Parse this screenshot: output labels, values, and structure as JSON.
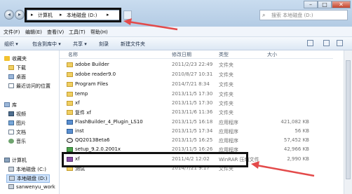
{
  "address": {
    "parts": [
      "▸",
      "计算机",
      "▸",
      "本地磁盘 (D:)",
      "▸"
    ]
  },
  "search": {
    "placeholder": "搜索 本地磁盘 (D:)"
  },
  "window_controls": {
    "minimize": "–",
    "maximize": "□",
    "close": "✕"
  },
  "menu": [
    "文件(F)",
    "编辑(E)",
    "查看(V)",
    "工具(T)",
    "帮助(H)"
  ],
  "toolbar": {
    "organize": "组织 ▾",
    "include": "包含到库中 ▾",
    "share": "共享 ▾",
    "burn": "刻录",
    "new_folder": "新建文件夹"
  },
  "nav": {
    "favorites": "收藏夹",
    "downloads": "下载",
    "desktop": "桌面",
    "recent": "最近访问的位置",
    "libraries": "库",
    "videos": "视频",
    "pictures": "图片",
    "documents": "文档",
    "music": "音乐",
    "computer": "计算机",
    "drive_c": "本地磁盘 (C:)",
    "drive_d": "本地磁盘 (D:)",
    "share": "sanwenyu_work"
  },
  "columns": {
    "name": "名称",
    "date": "修改日期",
    "type": "类型",
    "size": "大小"
  },
  "files": [
    {
      "name": "adobe Builder",
      "date": "2011/2/23 22:49",
      "type": "文件夹",
      "size": "",
      "icon": "folder"
    },
    {
      "name": "adobe reader9.0",
      "date": "2010/8/27 10:31",
      "type": "文件夹",
      "size": "",
      "icon": "folder"
    },
    {
      "name": "Program Files",
      "date": "2014/7/21 8:34",
      "type": "文件夹",
      "size": "",
      "icon": "folder"
    },
    {
      "name": "temp",
      "date": "2013/11/5 17:30",
      "type": "文件夹",
      "size": "",
      "icon": "folder"
    },
    {
      "name": "xf",
      "date": "2013/11/5 17:30",
      "type": "文件夹",
      "size": "",
      "icon": "folder"
    },
    {
      "name": "复件 xf",
      "date": "2013/11/6 11:36",
      "type": "文件夹",
      "size": "",
      "icon": "folder"
    },
    {
      "name": "FlashBuilder_4_Plugin_LS10",
      "date": "2013/11/5 16:18",
      "type": "应用程序",
      "size": "421,082 KB",
      "icon": "exe"
    },
    {
      "name": "inst",
      "date": "2013/11/5 17:34",
      "type": "应用程序",
      "size": "56 KB",
      "icon": "exe"
    },
    {
      "name": "QQ2013Beta6",
      "date": "2013/11/5 16:25",
      "type": "应用程序",
      "size": "57,452 KB",
      "icon": "qq"
    },
    {
      "name": "setup_9.2.0.2001x",
      "date": "2013/11/5 16:26",
      "type": "应用程序",
      "size": "42,966 KB",
      "icon": "setup"
    },
    {
      "name": "xf",
      "date": "2011/4/2 12:02",
      "type": "WinRAR 压缩文件",
      "size": "2,990 KB",
      "icon": "rar"
    },
    {
      "name": "测试",
      "date": "2014/7/21 9:17",
      "type": "文件夹",
      "size": "",
      "icon": "folder"
    }
  ],
  "colors": {
    "annotation_arrow": "#e34a4a",
    "highlight_box": "#111111"
  }
}
